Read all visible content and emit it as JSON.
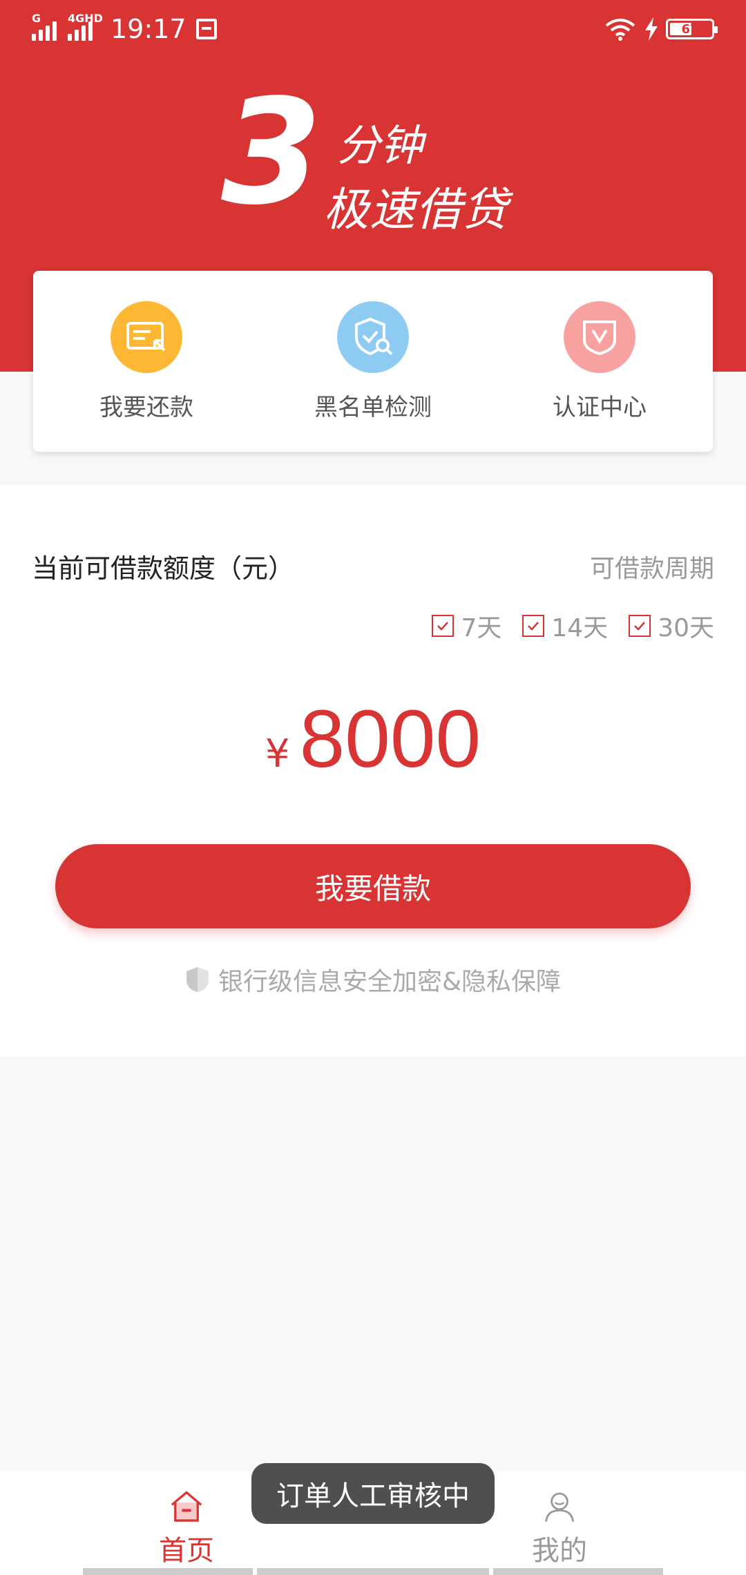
{
  "status_bar": {
    "time": "19:17",
    "network_1": "G",
    "network_2": "4GHD",
    "battery": "67"
  },
  "hero": {
    "number": "3",
    "line1": "分钟",
    "line2": "极速借贷"
  },
  "quick_actions": [
    {
      "label": "我要还款",
      "icon": "repay-card-icon",
      "color": "#fdb733"
    },
    {
      "label": "黑名单检测",
      "icon": "shield-search-icon",
      "color": "#8ecbf3"
    },
    {
      "label": "认证中心",
      "icon": "verify-shield-icon",
      "color": "#f7a1a1"
    }
  ],
  "loan": {
    "limit_label": "当前可借款额度（元）",
    "period_label": "可借款周期",
    "periods": [
      "7天",
      "14天",
      "30天"
    ],
    "currency": "¥",
    "amount": "8000",
    "button_label": "我要借款",
    "security_note": "银行级信息安全加密&隐私保障"
  },
  "toast": "订单人工审核中",
  "nav": {
    "home": "首页",
    "mine": "我的"
  },
  "colors": {
    "brand": "#d83434",
    "background": "#f8f8f8"
  }
}
